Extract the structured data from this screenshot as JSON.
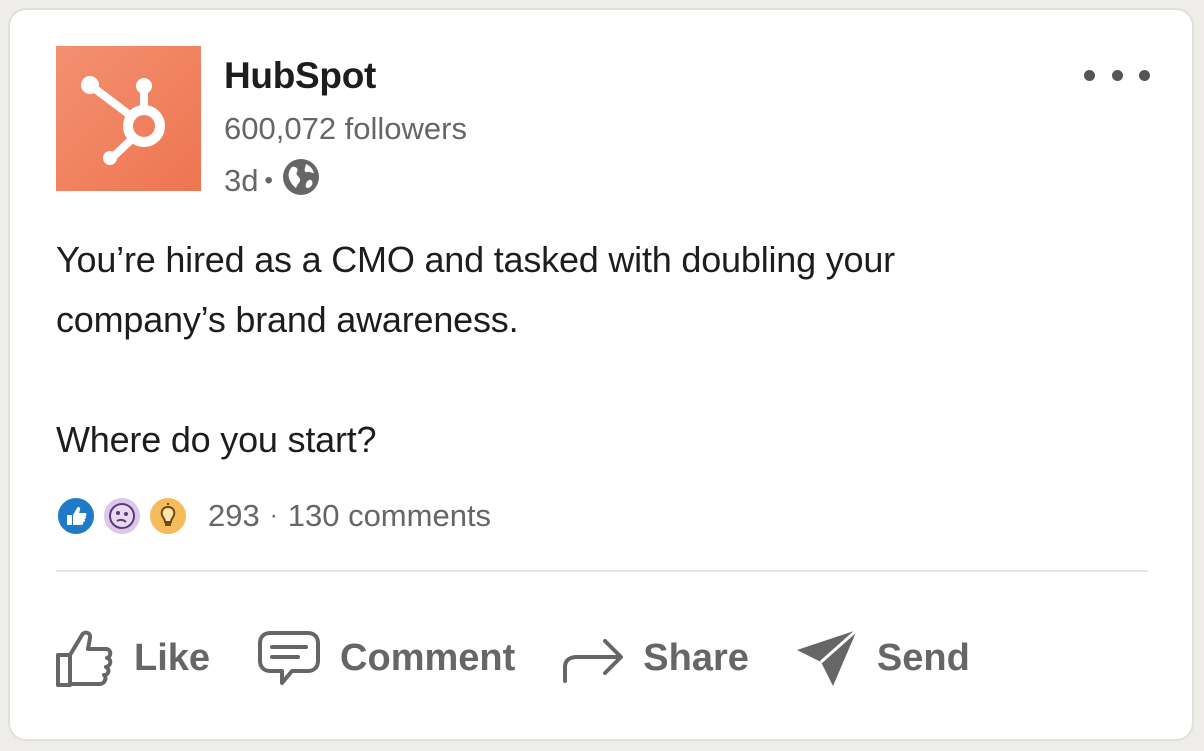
{
  "post": {
    "author": {
      "name": "HubSpot",
      "followers": "600,072 followers",
      "age": "3d",
      "separator": "•",
      "visibility_icon": "globe-icon",
      "logo_color": "#f08060"
    },
    "more_icon": "more-options-icon",
    "body": {
      "paragraph_1": "You’re hired as a CMO and tasked with doubling your company’s brand awareness.",
      "paragraph_2": "Where do you start?"
    },
    "social": {
      "reactions": [
        {
          "icon": "like-reaction-icon",
          "color": "#1f7bc7"
        },
        {
          "icon": "curious-reaction-icon",
          "color": "#dcc8ea"
        },
        {
          "icon": "insightful-reaction-icon",
          "color": "#f5bb5c"
        }
      ],
      "reaction_count": "293",
      "separator": "·",
      "comments": "130 comments"
    },
    "actions": {
      "like": "Like",
      "comment": "Comment",
      "share": "Share",
      "send": "Send"
    }
  }
}
